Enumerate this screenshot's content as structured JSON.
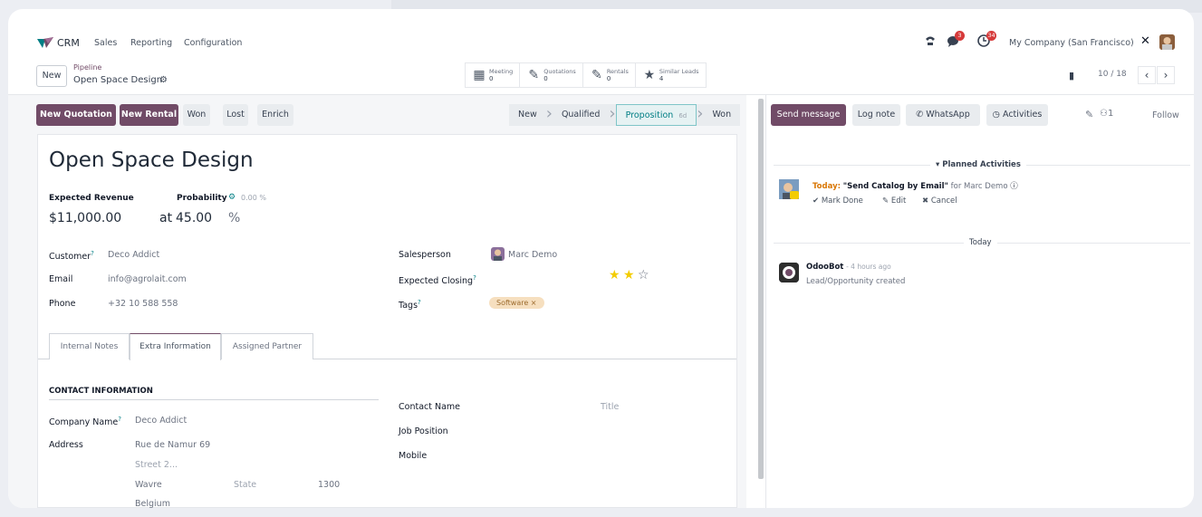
{
  "navbar": {
    "app": "CRM",
    "menu": [
      "Sales",
      "Reporting",
      "Configuration"
    ],
    "messages_badge": "3",
    "activities_badge": "34",
    "company": "My Company (San Francisco)"
  },
  "control": {
    "new_label": "New",
    "breadcrumb_parent": "Pipeline",
    "breadcrumb_current": "Open Space Design",
    "smart_buttons": [
      {
        "label": "Meeting",
        "count": "0",
        "icon": "calendar-icon"
      },
      {
        "label": "Quotations",
        "count": "0",
        "icon": "pencil-square-icon"
      },
      {
        "label": "Rentals",
        "count": "0",
        "icon": "pencil-square-icon"
      },
      {
        "label": "Similar Leads",
        "count": "4",
        "icon": "star-icon"
      }
    ],
    "pager": "10 / 18"
  },
  "actions": {
    "new_quotation": "New Quotation",
    "new_rental": "New Rental",
    "won": "Won",
    "lost": "Lost",
    "enrich": "Enrich"
  },
  "stages": {
    "new": "New",
    "qualified": "Qualified",
    "proposition": "Proposition",
    "proposition_days": "6d",
    "won": "Won"
  },
  "form": {
    "title": "Open Space Design",
    "expected_revenue_label": "Expected Revenue",
    "probability_label": "Probability",
    "probability_auto": "0.00 %",
    "expected_revenue": "$11,000.00",
    "at_label": "at",
    "probability": "45.00",
    "percent": "%",
    "customer_label": "Customer",
    "customer": "Deco Addict",
    "email_label": "Email",
    "email": "info@agrolait.com",
    "phone_label": "Phone",
    "phone": "+32 10 588 558",
    "salesperson_label": "Salesperson",
    "salesperson": "Marc Demo",
    "expected_closing_label": "Expected Closing",
    "priority_stars": 2,
    "tags_label": "Tags",
    "tag": "Software"
  },
  "tabs": [
    "Internal Notes",
    "Extra Information",
    "Assigned Partner"
  ],
  "extra": {
    "section": "CONTACT INFORMATION",
    "company_name_label": "Company Name",
    "company_name": "Deco Addict",
    "address_label": "Address",
    "street": "Rue de Namur 69",
    "street2": "Street 2...",
    "city": "Wavre",
    "state": "State",
    "zip": "1300",
    "country": "Belgium",
    "contact_name_label": "Contact Name",
    "title_placeholder": "Title",
    "job_position_label": "Job Position",
    "mobile_label": "Mobile"
  },
  "chatter": {
    "send_message": "Send message",
    "log_note": "Log note",
    "whatsapp": "WhatsApp",
    "activities": "Activities",
    "attachments_count": "1",
    "follow": "Follow",
    "planned_header": "Planned Activities",
    "activity_today": "Today:",
    "activity_summary": "\"Send Catalog by Email\"",
    "activity_for": "for Marc Demo",
    "mark_done": "Mark Done",
    "edit": "Edit",
    "cancel": "Cancel",
    "today_sep": "Today",
    "bot_name": "OdooBot",
    "bot_time": "- 4 hours ago",
    "bot_message": "Lead/Opportunity created"
  },
  "colors": {
    "primary": "#714b67",
    "accent": "#017e84",
    "badge": "#d63a3a",
    "star": "#f3cc00"
  }
}
